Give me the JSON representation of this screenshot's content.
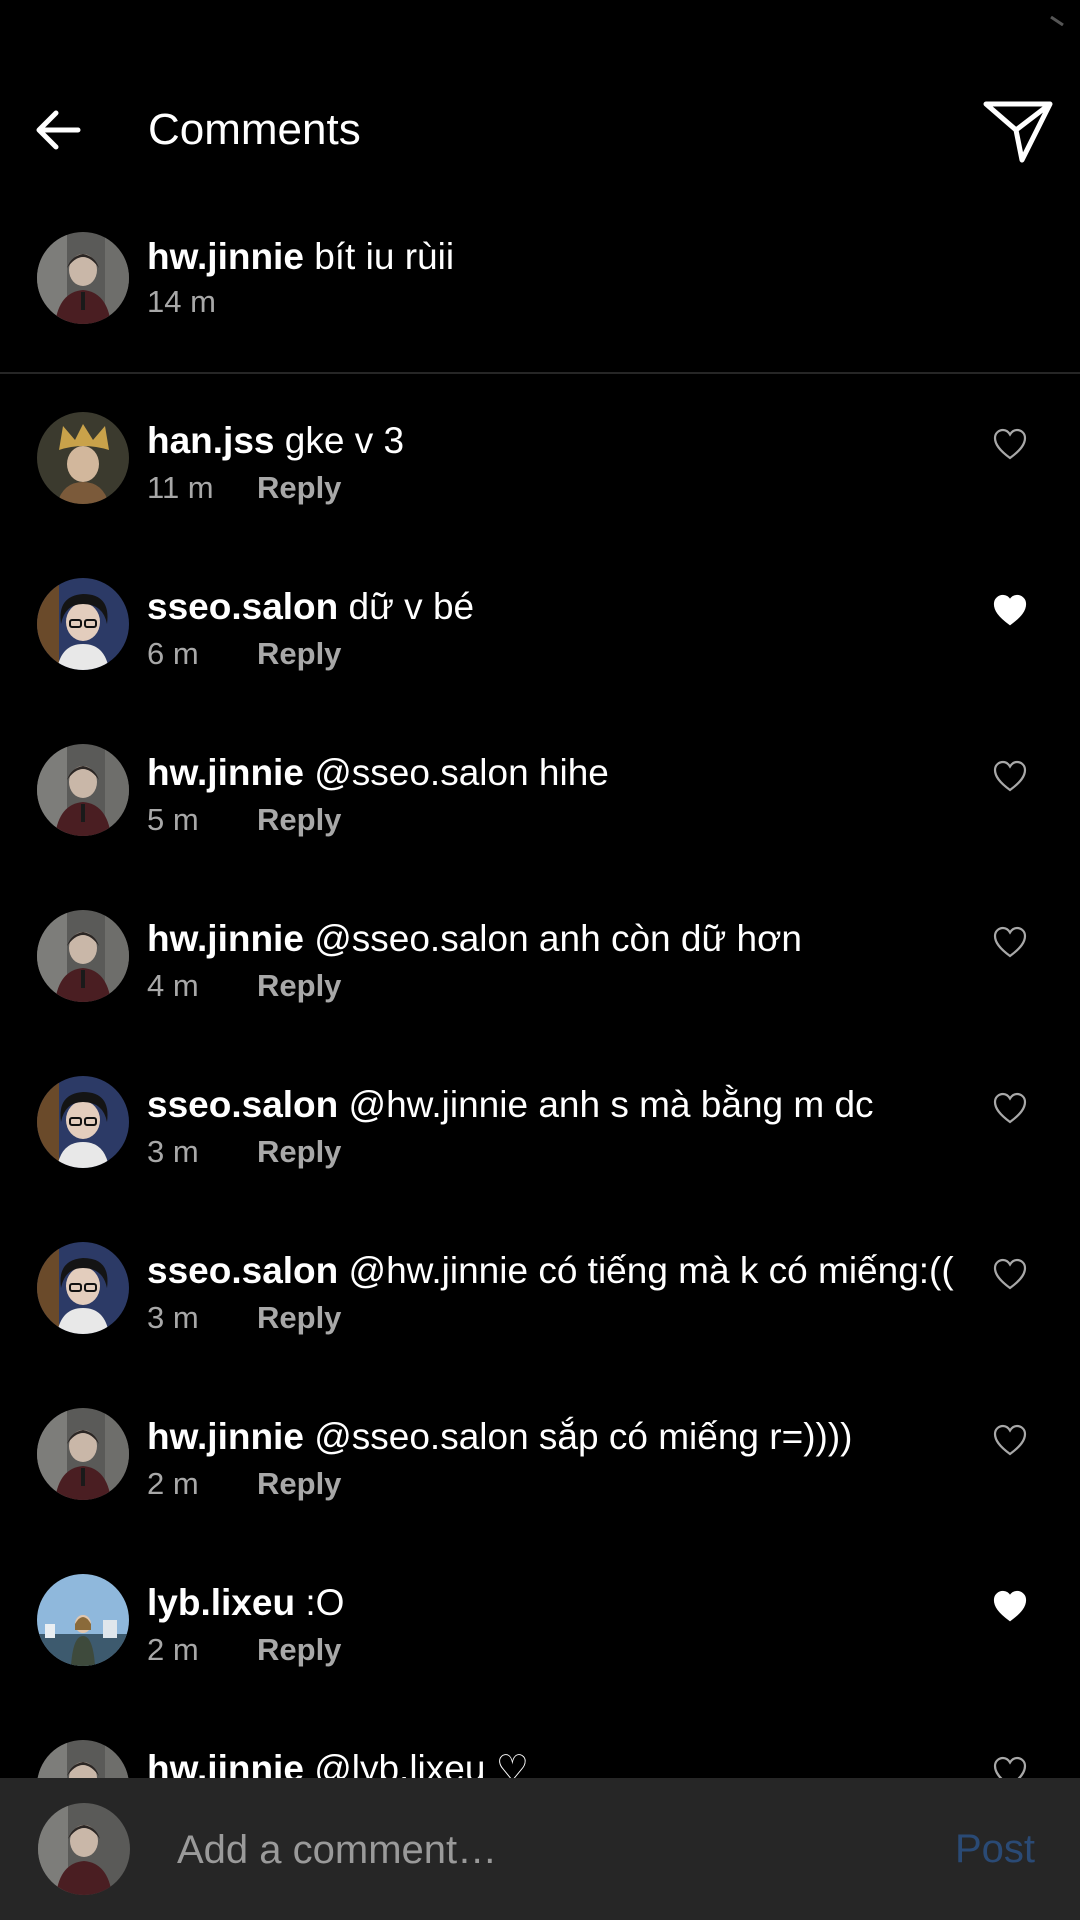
{
  "header": {
    "title": "Comments",
    "back_icon": "arrow-left-icon",
    "send_icon": "send-icon"
  },
  "caption": {
    "username": "hw.jinnie",
    "text": "bít iu rùii",
    "time": "14 m"
  },
  "comments": [
    {
      "username": "han.jss",
      "text": "gke v 3",
      "time": "11 m",
      "reply": "Reply",
      "liked": false,
      "avatar": "yellow-hat"
    },
    {
      "username": "sseo.salon",
      "text": "dữ v bé",
      "time": "6 m",
      "reply": "Reply",
      "liked": true,
      "avatar": "dark-hair"
    },
    {
      "username": "hw.jinnie",
      "text": "@sseo.salon hihe",
      "time": "5 m",
      "reply": "Reply",
      "liked": false,
      "avatar": "uniform"
    },
    {
      "username": "hw.jinnie",
      "text": "@sseo.salon anh còn dữ hơn",
      "time": "4 m",
      "reply": "Reply",
      "liked": false,
      "avatar": "uniform"
    },
    {
      "username": "sseo.salon",
      "text": "@hw.jinnie anh s mà bằng m dc",
      "time": "3 m",
      "reply": "Reply",
      "liked": false,
      "avatar": "dark-hair"
    },
    {
      "username": "sseo.salon",
      "text": "@hw.jinnie có tiếng mà k có miếng:((",
      "time": "3 m",
      "reply": "Reply",
      "liked": false,
      "avatar": "dark-hair"
    },
    {
      "username": "hw.jinnie",
      "text": "@sseo.salon sắp có miếng r=))))",
      "time": "2 m",
      "reply": "Reply",
      "liked": false,
      "avatar": "uniform"
    },
    {
      "username": "lyb.lixeu",
      "text": ":O",
      "time": "2 m",
      "reply": "Reply",
      "liked": true,
      "avatar": "sky"
    },
    {
      "username": "hw.jinnie",
      "text": "@lyb.lixeu ♡",
      "time": "",
      "reply": "",
      "liked": false,
      "avatar": "uniform"
    }
  ],
  "composer": {
    "placeholder": "Add a comment…",
    "post_label": "Post"
  },
  "colors": {
    "background": "#000000",
    "secondary_text": "#a8a8a8",
    "composer_bg": "#262626",
    "post_disabled": "#2a4a75",
    "heart_liked": "#ffffff"
  }
}
